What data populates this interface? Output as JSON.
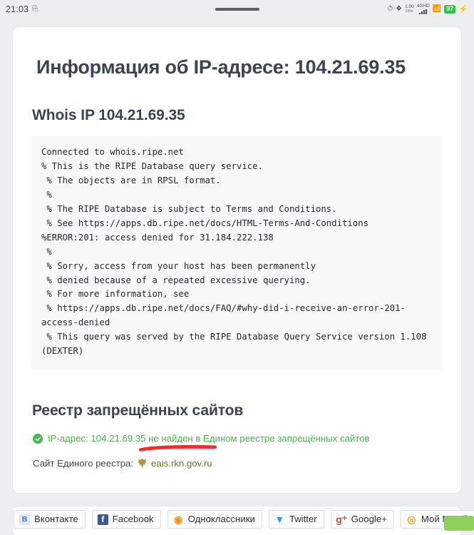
{
  "statusbar": {
    "clock": "21:03",
    "screenshot_icon": "screenshot-icon",
    "alarm_icon": "alarm-icon",
    "bluetooth_icon": "bluetooth-icon",
    "data_rate": "1.00",
    "data_rate_unit": "KB/s",
    "network_type": "4G",
    "hd_label": "HD",
    "wifi_icon": "wifi-icon",
    "battery_percent": "97",
    "charging_icon": "charging-bolt-icon"
  },
  "page": {
    "title": "Информация об IP-адресе: 104.21.69.35",
    "whois_heading": "Whois IP 104.21.69.35",
    "whois_output": "Connected to whois.ripe.net\n% This is the RIPE Database query service.\n % The objects are in RPSL format.\n %\n % The RIPE Database is subject to Terms and Conditions.\n % See https://apps.db.ripe.net/docs/HTML-Terms-And-Conditions\n%ERROR:201: access denied for 31.184.222.138\n %\n % Sorry, access from your host has been permanently\n % denied because of a repeated excessive querying.\n % For more information, see\n % https://apps.db.ripe.net/docs/FAQ/#why-did-i-receive-an-error-201-access-denied\n % This query was served by the RIPE Database Query Service version 1.108 (DEXTER)",
    "registry_heading": "Реестр запрещённых сайтов",
    "registry_status_text": "IP-адрес: 104.21.69.35 не найден в Едином реестре запрещённых сайтов",
    "registry_link_label": "Сайт Единого реестра:",
    "registry_link_text": "eais.rkn.gov.ru"
  },
  "social": {
    "buttons": [
      {
        "label": "Вконтакте",
        "icon": "vkontakte-icon",
        "glyph": "В",
        "cls": "ic-vk"
      },
      {
        "label": "Facebook",
        "icon": "facebook-icon",
        "glyph": "f",
        "cls": "ic-fb"
      },
      {
        "label": "Одноклассники",
        "icon": "odnoklassniki-icon",
        "glyph": "◉",
        "cls": "ic-ok"
      },
      {
        "label": "Twitter",
        "icon": "twitter-icon",
        "glyph": "▼",
        "cls": "ic-tw"
      },
      {
        "label": "Google+",
        "icon": "googleplus-icon",
        "glyph": "g⁺",
        "cls": "ic-gp"
      },
      {
        "label": "Мой Мир@Mail.Ru",
        "icon": "moimir-mailru-icon",
        "glyph": "◎",
        "cls": "ic-mm"
      }
    ]
  },
  "colors": {
    "accent_green": "#49b65b",
    "status_text_green": "#54b055",
    "annotation_red": "#ef2b2b",
    "link_olive": "#6d7a1f",
    "battery_green": "#2fc24d",
    "heading": "#3b4450"
  }
}
